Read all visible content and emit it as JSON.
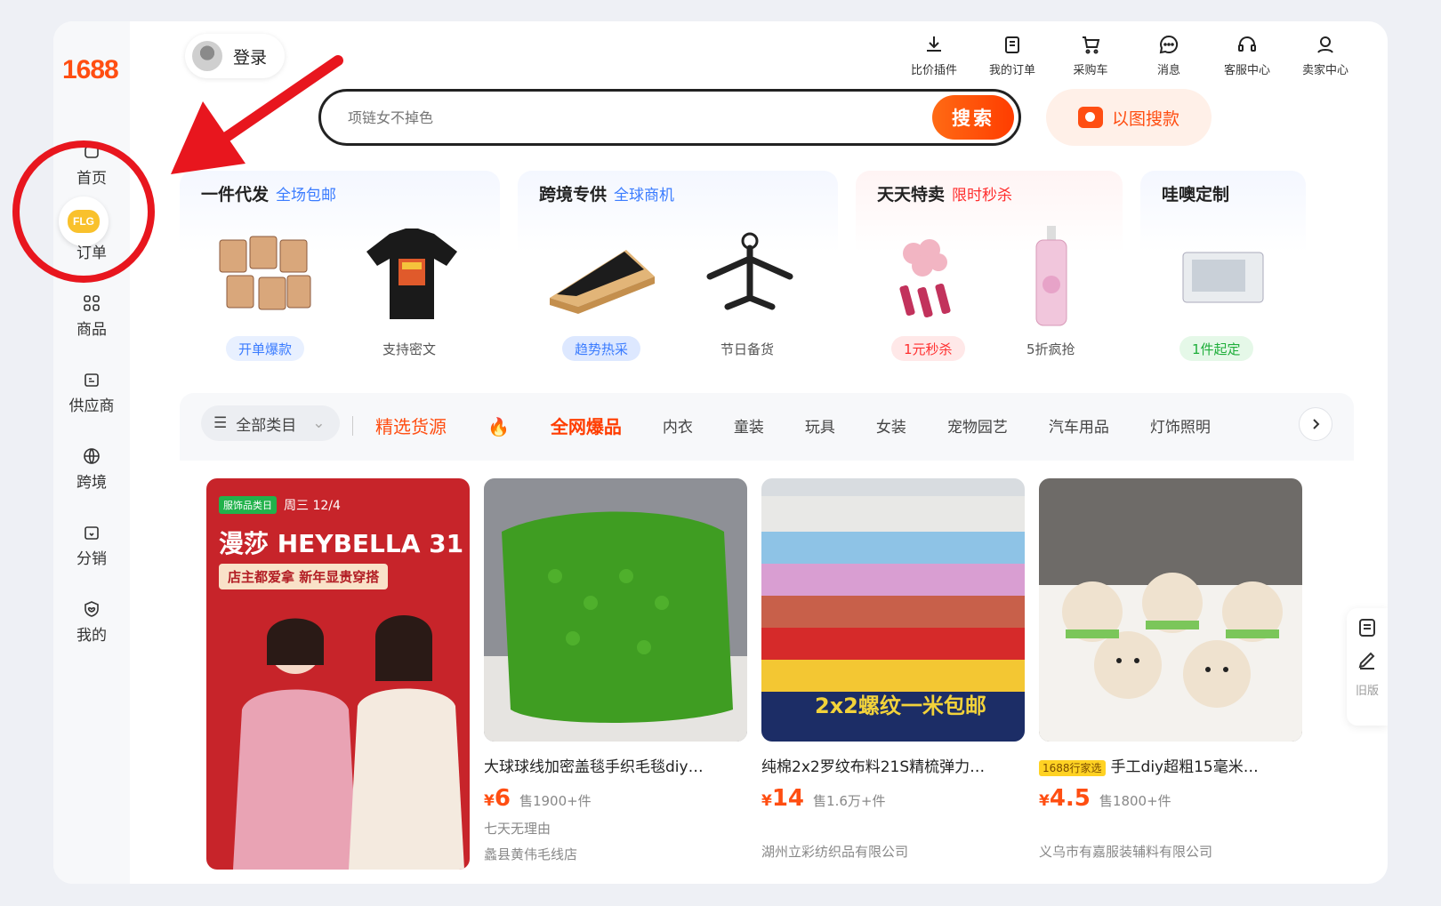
{
  "app": {
    "logo": "1688"
  },
  "sidebar": {
    "flg_badge": "FLG",
    "items": [
      {
        "label": "首页",
        "icon": "home-icon"
      },
      {
        "label": "订单",
        "icon": "order-icon"
      },
      {
        "label": "商品",
        "icon": "grid-icon"
      },
      {
        "label": "供应商",
        "icon": "supplier-icon"
      },
      {
        "label": "跨境",
        "icon": "globe-icon"
      },
      {
        "label": "分销",
        "icon": "distribution-icon"
      },
      {
        "label": "我的",
        "icon": "heart-shield-icon"
      }
    ]
  },
  "header": {
    "login_label": "登录",
    "nav": [
      {
        "label": "比价插件",
        "icon": "download-icon"
      },
      {
        "label": "我的订单",
        "icon": "clipboard-icon"
      },
      {
        "label": "采购车",
        "icon": "cart-icon"
      },
      {
        "label": "消息",
        "icon": "chat-icon"
      },
      {
        "label": "客服中心",
        "icon": "headset-icon"
      },
      {
        "label": "卖家中心",
        "icon": "user-icon"
      }
    ],
    "search_placeholder": "项链女不掉色",
    "search_button": "搜索",
    "image_search": "以图搜款"
  },
  "cards": [
    {
      "title": "一件代发",
      "subtitle": "全场包邮",
      "subtitle_color": "#3b7cff",
      "left_tag": "开单爆款",
      "right_label": "支持密文",
      "tag_bg": "#e8f0ff",
      "tag_color": "#3b7cff"
    },
    {
      "title": "跨境专供",
      "subtitle": "全球商机",
      "subtitle_color": "#3b7cff",
      "left_tag": "趋势热采",
      "right_label": "节日备货",
      "tag_bg": "#dde8ff",
      "tag_color": "#3b7cff"
    },
    {
      "title": "天天特卖",
      "subtitle": "限时秒杀",
      "subtitle_color": "#ff2e2e",
      "left_tag": "1元秒杀",
      "right_label": "5折疯抢",
      "tag_bg": "#ffe8e8",
      "tag_color": "#ff2e2e"
    },
    {
      "title": "哇噢定制",
      "subtitle": "",
      "subtitle_color": "#333",
      "left_tag": "1件起定",
      "right_label": "",
      "tag_bg": "#e5f8e8",
      "tag_color": "#1eae3a"
    }
  ],
  "categories": {
    "all_label": "全部类目",
    "featured": "精选货源",
    "hot": "全网爆品",
    "items": [
      "内衣",
      "童装",
      "玩具",
      "女装",
      "宠物园艺",
      "汽车用品",
      "灯饰照明"
    ]
  },
  "products": [
    {
      "banner": true,
      "badge": "服饰品类日",
      "date": "周三 12/4",
      "brand": "漫莎 HEYBELLA 31",
      "slogan": "店主都爱拿 新年显贵穿搭"
    },
    {
      "name": "大球球线加密盖毯手织毛毯diy…",
      "price_symbol": "¥",
      "price": "6",
      "sold": "售1900+件",
      "meta": "七天无理由",
      "shop": "蠡县黄伟毛线店"
    },
    {
      "name": "纯棉2x2罗纹布料21S精梳弹力…",
      "price_symbol": "¥",
      "price": "14",
      "sold": "售1.6万+件",
      "meta": "",
      "shop": "湖州立彩纺织品有限公司",
      "overlay_text": "2x2螺纹一米包邮"
    },
    {
      "badge": "1688行家选",
      "name": "手工diy超粗15毫米…",
      "price_symbol": "¥",
      "price": "4.5",
      "sold": "售1800+件",
      "meta": "",
      "shop": "义乌市有嘉服装辅料有限公司"
    }
  ],
  "right_tools": {
    "old_label": "旧版"
  },
  "colors": {
    "accent": "#ff4e12",
    "annotation": "#e8161e"
  }
}
